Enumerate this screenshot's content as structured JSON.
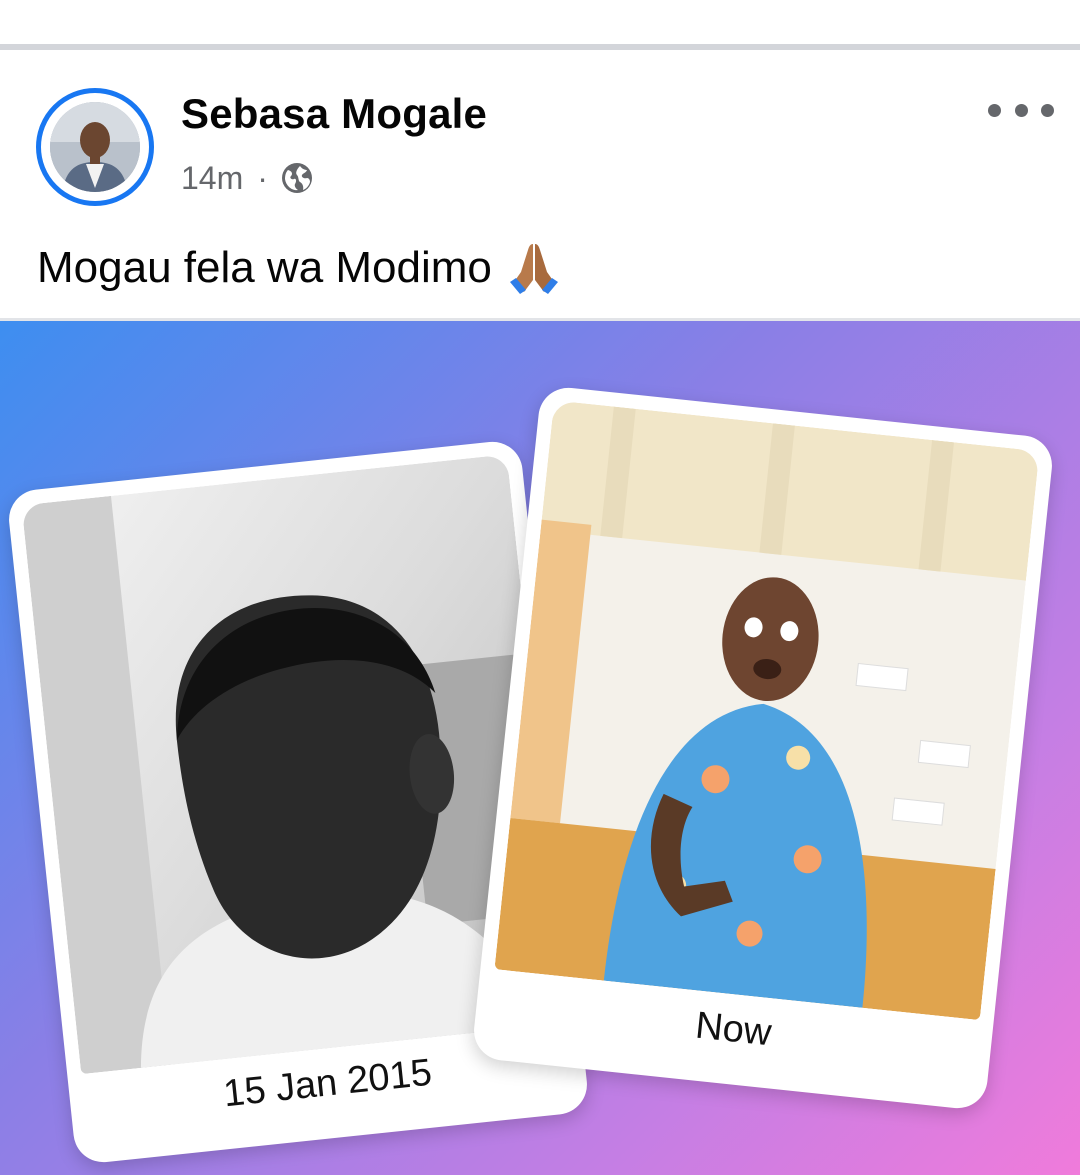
{
  "post": {
    "author": "Sebasa Mogale",
    "time": "14m",
    "separator": "·",
    "privacy_icon": "globe-icon",
    "more_icon": "more-options-icon",
    "caption": "Mogau fela wa Modimo",
    "caption_emoji": "folded-hands-icon"
  },
  "image": {
    "cards": [
      {
        "label": "15 Jan 2015"
      },
      {
        "label": "Now"
      }
    ]
  },
  "colors": {
    "accent": "#1877f2",
    "text": "#050505",
    "secondary_text": "#65676b",
    "gradient": [
      "#3d8ef0",
      "#8a7fe6",
      "#c47ee4",
      "#f07bdb"
    ]
  }
}
